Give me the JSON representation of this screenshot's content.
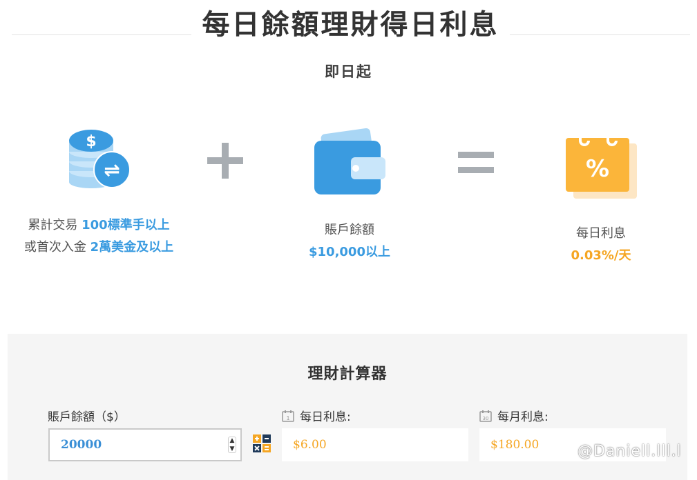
{
  "header": {
    "title": "每日餘額理財得日利息",
    "subtitle": "即日起"
  },
  "conditions": {
    "trade": {
      "line1_prefix": "累計交易 ",
      "line1_highlight": "100標準手以上",
      "line2_prefix": "或首次入金 ",
      "line2_highlight": "2萬美金及以上"
    },
    "balance": {
      "label": "賬戶餘額",
      "value": "$10,000以上"
    },
    "interest": {
      "label": "每日利息",
      "value": "0.03%/天"
    }
  },
  "icons": {
    "coins_symbol": "$",
    "exchange_symbol": "⇌",
    "percent_symbol": "%"
  },
  "calculator": {
    "title": "理財計算器",
    "balance_label": "賬戶餘額（$）",
    "balance_value": "20000",
    "daily_label": "每日利息:",
    "daily_value": "$6.00",
    "daily_cal_num": "1",
    "monthly_label": "每月利息:",
    "monthly_value": "$180.00",
    "monthly_cal_num": "30"
  },
  "watermark": "@Daniell.lll.l",
  "colors": {
    "blue": "#3a9be0",
    "orange": "#f5a623",
    "gray_operator": "#a8adb2"
  }
}
